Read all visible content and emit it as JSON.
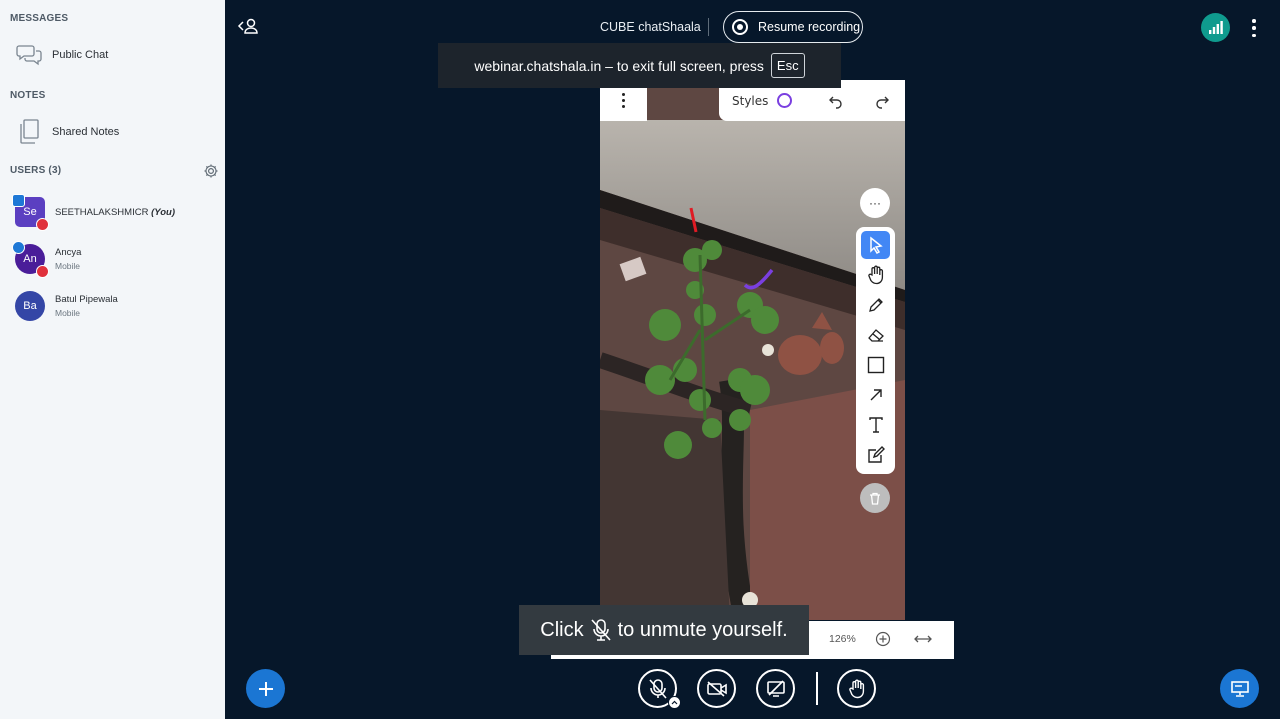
{
  "sidebar": {
    "messages_title": "MESSAGES",
    "public_chat": "Public Chat",
    "notes_title": "NOTES",
    "shared_notes": "Shared Notes",
    "users_title": "USERS (3)",
    "users": [
      {
        "initials": "Se",
        "name": "SEETHALAKSHMICR",
        "you": "(You)",
        "sub": "",
        "color": "#5b3fc1"
      },
      {
        "initials": "An",
        "name": "Ancya",
        "sub": "Mobile",
        "color": "#4a1d99"
      },
      {
        "initials": "Ba",
        "name": "Batul Pipewala",
        "sub": "Mobile",
        "color": "#3446a6"
      }
    ]
  },
  "header": {
    "title": "CUBE chatShaala",
    "record_label": "Resume recording"
  },
  "whiteboard": {
    "styles_label": "Styles",
    "style_color": "#7a3fe0",
    "zoom": "126%",
    "more_glyph": "···"
  },
  "toasts": {
    "fullscreen_prefix": "webinar.chatshala.in – to exit full screen, press",
    "fullscreen_key": "Esc",
    "mute_before": "Click",
    "mute_after": "to unmute yourself."
  },
  "colors": {
    "sidebar_bg": "#f3f6f9",
    "main_bg": "#06172a",
    "accent": "#1b76d3",
    "connection": "#0f9b8e"
  }
}
